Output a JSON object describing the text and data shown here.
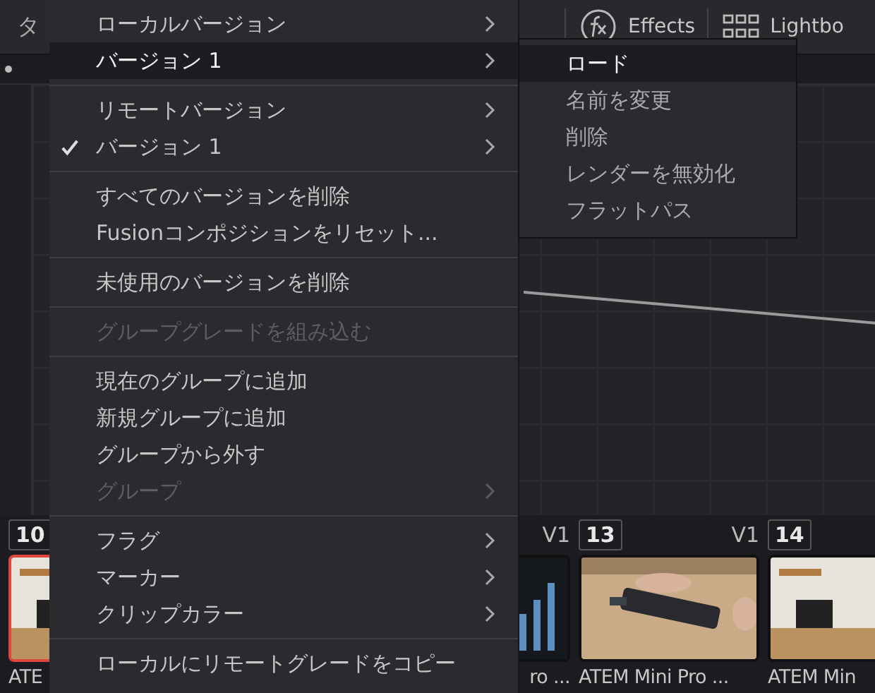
{
  "toolbar": {
    "fragment": "タ",
    "buttons": [
      {
        "label": "Effects",
        "kind": "fx"
      },
      {
        "label": "Lightbo",
        "kind": "grid"
      }
    ]
  },
  "clips": [
    {
      "number": "10",
      "title": "ATE",
      "selected": true
    },
    {
      "track": "V1",
      "title": "ro ...",
      "selected": false
    },
    {
      "number": "13",
      "track": "V1",
      "title": "ATEM Mini Pro ...",
      "selected": false
    },
    {
      "number": "14",
      "title": "ATEM Min",
      "selected": false
    }
  ],
  "context_menu": {
    "items": [
      {
        "kind": "item",
        "label": "ローカルバージョン",
        "submenu": true,
        "checked": false,
        "disabled": false,
        "selected": false
      },
      {
        "kind": "item",
        "label": "バージョン 1",
        "submenu": true,
        "checked": false,
        "disabled": false,
        "selected": true
      },
      {
        "kind": "separator"
      },
      {
        "kind": "item",
        "label": "リモートバージョン",
        "submenu": true,
        "checked": false,
        "disabled": false,
        "selected": false
      },
      {
        "kind": "item",
        "label": "バージョン 1",
        "submenu": true,
        "checked": true,
        "disabled": false,
        "selected": false
      },
      {
        "kind": "separator"
      },
      {
        "kind": "item",
        "label": "すべてのバージョンを削除",
        "submenu": false,
        "checked": false,
        "disabled": false,
        "selected": false
      },
      {
        "kind": "item",
        "label": "Fusionコンポジションをリセット...",
        "submenu": false,
        "checked": false,
        "disabled": false,
        "selected": false
      },
      {
        "kind": "separator"
      },
      {
        "kind": "item",
        "label": "未使用のバージョンを削除",
        "submenu": false,
        "checked": false,
        "disabled": false,
        "selected": false
      },
      {
        "kind": "separator"
      },
      {
        "kind": "item",
        "label": "グループグレードを組み込む",
        "submenu": false,
        "checked": false,
        "disabled": true,
        "selected": false
      },
      {
        "kind": "separator"
      },
      {
        "kind": "item",
        "label": "現在のグループに追加",
        "submenu": false,
        "checked": false,
        "disabled": false,
        "selected": false
      },
      {
        "kind": "item",
        "label": "新規グループに追加",
        "submenu": false,
        "checked": false,
        "disabled": false,
        "selected": false
      },
      {
        "kind": "item",
        "label": "グループから外す",
        "submenu": false,
        "checked": false,
        "disabled": false,
        "selected": false
      },
      {
        "kind": "item",
        "label": "グループ",
        "submenu": true,
        "checked": false,
        "disabled": true,
        "selected": false
      },
      {
        "kind": "separator"
      },
      {
        "kind": "item",
        "label": "フラグ",
        "submenu": true,
        "checked": false,
        "disabled": false,
        "selected": false
      },
      {
        "kind": "item",
        "label": "マーカー",
        "submenu": true,
        "checked": false,
        "disabled": false,
        "selected": false
      },
      {
        "kind": "item",
        "label": "クリップカラー",
        "submenu": true,
        "checked": false,
        "disabled": false,
        "selected": false
      },
      {
        "kind": "separator"
      },
      {
        "kind": "item",
        "label": "ローカルにリモートグレードをコピー",
        "submenu": false,
        "checked": false,
        "disabled": false,
        "selected": false
      }
    ]
  },
  "submenu": {
    "items": [
      {
        "label": "ロード",
        "selected": true
      },
      {
        "label": "名前を変更",
        "selected": false
      },
      {
        "label": "削除",
        "selected": false
      },
      {
        "label": "レンダーを無効化",
        "selected": false
      },
      {
        "label": "フラットパス",
        "selected": false
      }
    ]
  }
}
